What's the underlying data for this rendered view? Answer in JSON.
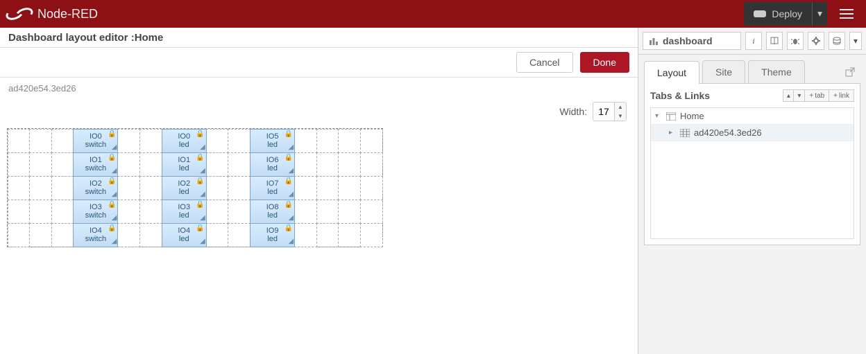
{
  "brand": "Node-RED",
  "deploy_label": "Deploy",
  "editor": {
    "title_prefix": "Dashboard layout editor : ",
    "title_tab": "Home",
    "cancel": "Cancel",
    "done": "Done",
    "crumb": "ad420e54.3ed26",
    "width_label": "Width:",
    "width_value": "17"
  },
  "grid": {
    "cols": 17,
    "rows": 5,
    "widgets": [
      {
        "col": 4,
        "row": 0,
        "title": "IO0",
        "sub": "switch"
      },
      {
        "col": 8,
        "row": 0,
        "title": "IO0",
        "sub": "led"
      },
      {
        "col": 12,
        "row": 0,
        "title": "IO5",
        "sub": "led"
      },
      {
        "col": 4,
        "row": 1,
        "title": "IO1",
        "sub": "switch"
      },
      {
        "col": 8,
        "row": 1,
        "title": "IO1",
        "sub": "led"
      },
      {
        "col": 12,
        "row": 1,
        "title": "IO6",
        "sub": "led"
      },
      {
        "col": 4,
        "row": 2,
        "title": "IO2",
        "sub": "switch"
      },
      {
        "col": 8,
        "row": 2,
        "title": "IO2",
        "sub": "led"
      },
      {
        "col": 12,
        "row": 2,
        "title": "IO7",
        "sub": "led"
      },
      {
        "col": 4,
        "row": 3,
        "title": "IO3",
        "sub": "switch"
      },
      {
        "col": 8,
        "row": 3,
        "title": "IO3",
        "sub": "led"
      },
      {
        "col": 12,
        "row": 3,
        "title": "IO8",
        "sub": "led"
      },
      {
        "col": 4,
        "row": 4,
        "title": "IO4",
        "sub": "switch"
      },
      {
        "col": 8,
        "row": 4,
        "title": "IO4",
        "sub": "led"
      },
      {
        "col": 12,
        "row": 4,
        "title": "IO9",
        "sub": "led"
      }
    ]
  },
  "sidebar": {
    "panel_label": "dashboard",
    "icons": [
      "info-letter-icon",
      "book-icon",
      "bug-icon",
      "gear-icon",
      "stack-icon"
    ],
    "tabs": [
      "Layout",
      "Site",
      "Theme"
    ],
    "tabs_links_label": "Tabs & Links",
    "add_tab": "tab",
    "add_link": "link",
    "tree": {
      "root": "Home",
      "child": "ad420e54.3ed26"
    }
  }
}
